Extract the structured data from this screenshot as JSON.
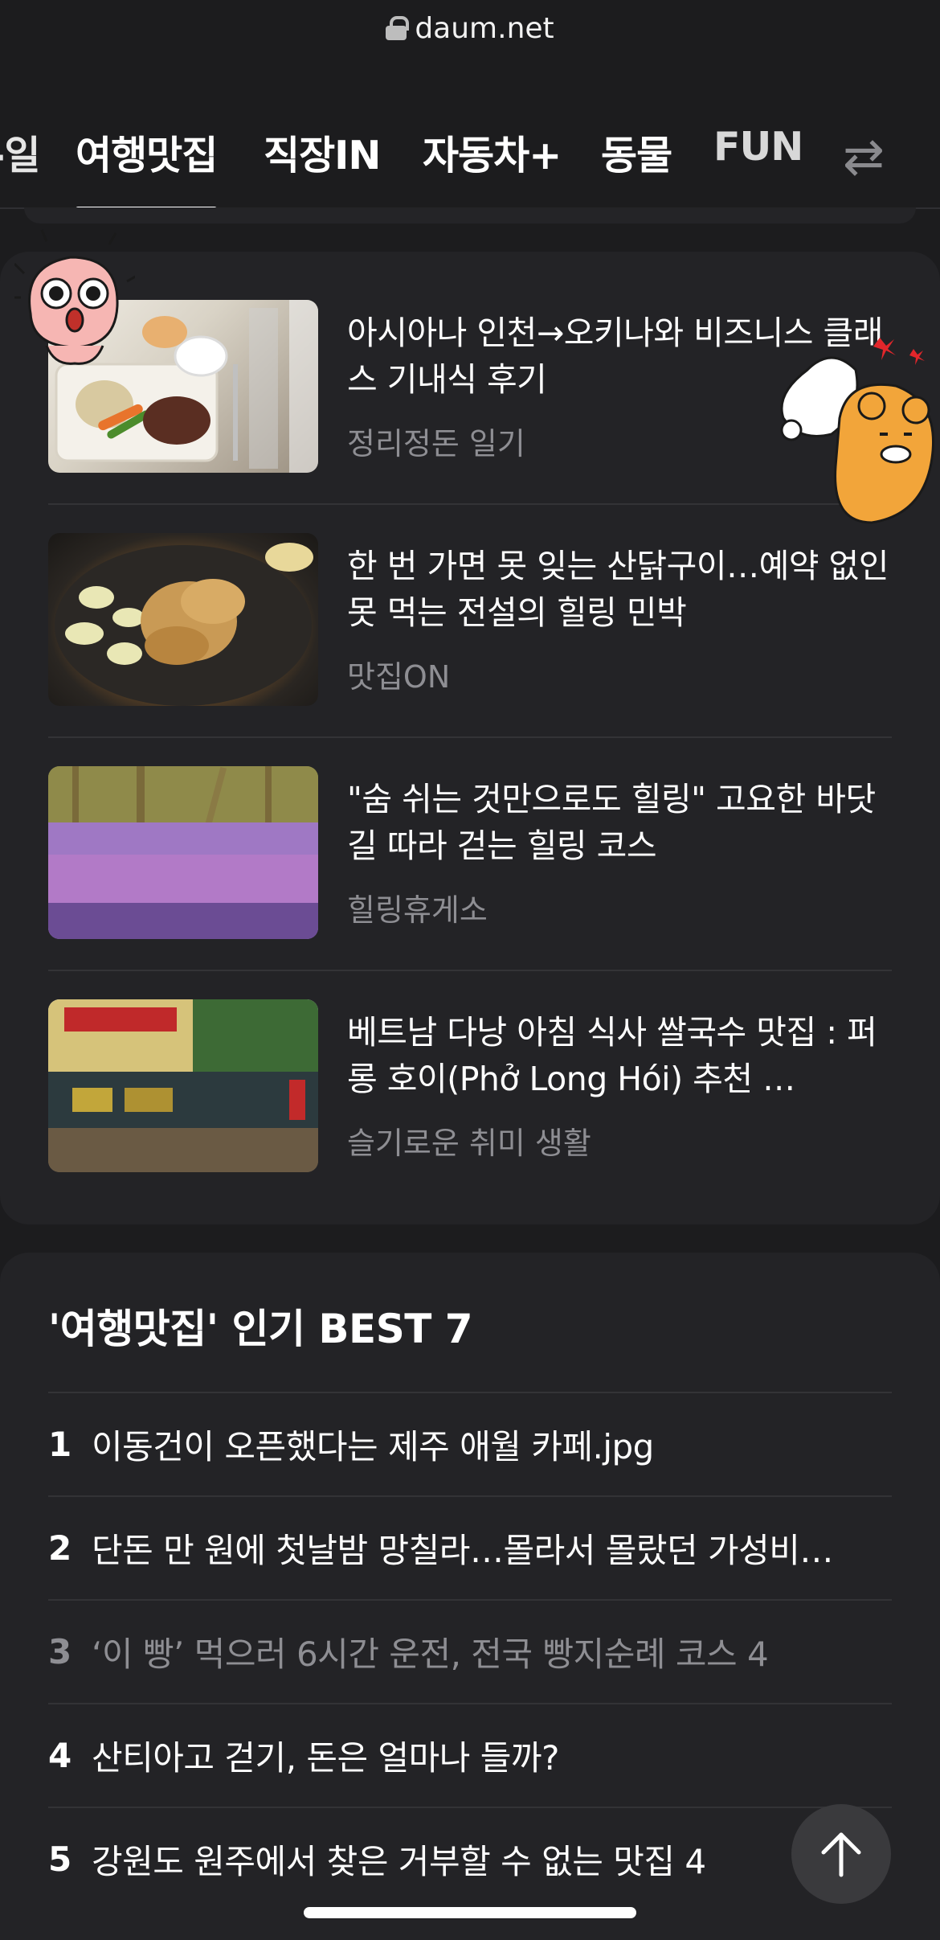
{
  "browser": {
    "url": "daum.net"
  },
  "tabs": [
    {
      "label": "-일"
    },
    {
      "label": "여행맛집",
      "active": true
    },
    {
      "label": "직장IN"
    },
    {
      "label": "자동차+"
    },
    {
      "label": "동물"
    },
    {
      "label": "FUN"
    }
  ],
  "articles": [
    {
      "title": "아시아나 인천→오키나와 비즈니스 클래스 기내식 후기",
      "source": "정리정돈 일기"
    },
    {
      "title": "한 번 가면 못 잊는 산닭구이…예약 없인 못 먹는 전설의 힐링 민박",
      "source": "맛집ON"
    },
    {
      "title": "\"숨 쉬는 것만으로도 힐링\" 고요한 바닷길 따라 걷는 힐링 코스",
      "source": "힐링휴게소"
    },
    {
      "title": "베트남 다낭 아침 식사 쌀국수 맛집 : 퍼 롱 호이(Phở Long Hói) 추천 …",
      "source": "슬기로운 취미 생활"
    }
  ],
  "best": {
    "title": "'여행맛집' 인기 BEST 7",
    "items": [
      {
        "rank": "1",
        "text": "이동건이 오픈했다는 제주 애월 카페.jpg"
      },
      {
        "rank": "2",
        "text": "단돈 만 원에 첫날밤 망칠라…몰라서 몰랐던 가성비…"
      },
      {
        "rank": "3",
        "text": "‘이 빵’ 먹으러 6시간 운전, 전국 빵지순례 코스 4"
      },
      {
        "rank": "4",
        "text": "산티아고 걷기, 돈은 얼마나 들까?"
      },
      {
        "rank": "5",
        "text": "강원도 원주에서 찾은 거부할 수 없는 맛집 4"
      }
    ]
  },
  "icons": {
    "lock": "lock-icon",
    "swap": "swap-arrows-icon",
    "top": "arrow-up-icon"
  },
  "colors": {
    "background": "#1c1c1e",
    "card": "#232326",
    "text": "#ffffff",
    "muted": "#8e8e93"
  }
}
